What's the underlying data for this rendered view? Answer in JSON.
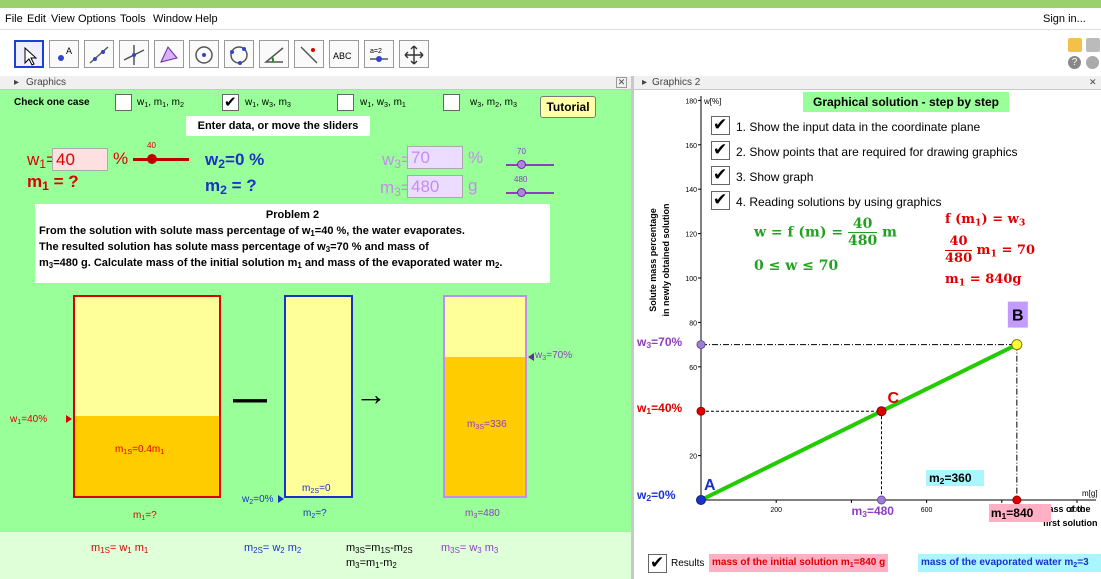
{
  "menu": {
    "items": [
      "File",
      "Edit",
      "View",
      "Options",
      "Tools",
      "Window",
      "Help"
    ],
    "sign_in": "Sign in..."
  },
  "toolbar": {
    "abc_label": "ABC",
    "slider_label": "a=2"
  },
  "left_panel": {
    "title": "Graphics",
    "check_label": "Check one case",
    "cases": [
      {
        "label": "w<sub>1</sub>, m<sub>1</sub>, m<sub>2</sub>",
        "checked": false
      },
      {
        "label": "w<sub>1</sub>, w<sub>3</sub>, m<sub>3</sub>",
        "checked": true
      },
      {
        "label": "w<sub>1</sub>, w<sub>3</sub>, m<sub>1</sub>",
        "checked": false
      },
      {
        "label": "w<sub>3</sub>, m<sub>2</sub>, m<sub>3</sub>",
        "checked": false
      }
    ],
    "tutorial_label": "Tutorial",
    "enter_data": "Enter data, or move the sliders",
    "w1_label": "w<sub>1</sub>=",
    "w1_value": "40",
    "w1_unit": "%",
    "w1_slider_value": "40",
    "w2_text": "w<sub>2</sub>=0 %",
    "w3_label": "w<sub>3</sub>=",
    "w3_value": "70",
    "w3_unit": "%",
    "w3_slider_value": "70",
    "m1_text": "m<sub>1</sub> = ?",
    "m2_text": "m<sub>2</sub> = ?",
    "m3_label": "m<sub>3</sub>=",
    "m3_value": "480",
    "m3_unit": "g",
    "m3_slider_value": "480",
    "problem_title": "Problem 2",
    "problem_lines": [
      "From the solution with solute mass percentage of w<sub>1</sub>=40 %, the water evaporates.",
      "The resulted solution has solute mass percentage of w<sub>3</sub>=70 % and mass of",
      "m<sub>3</sub>=480 g. Calculate mass of the initial solution m<sub>1</sub> and mass of the evaporated water m<sub>2</sub>."
    ],
    "beaker1": {
      "w_label": "w<sub>1</sub>=40%",
      "inner": "m<sub>1S</sub>=0.4m<sub>1</sub>",
      "bottom": "m<sub>1</sub>=?",
      "fill": 0.4
    },
    "beaker2": {
      "w_label": "w<sub>2</sub>=0%",
      "inner": "m<sub>2S</sub>=0",
      "bottom": "m<sub>2</sub>=?"
    },
    "beaker3": {
      "w_label": "w<sub>3</sub>=70%",
      "inner": "m<sub>3S</sub>=336",
      "bottom": "m<sub>3</sub>=480",
      "fill": 0.7
    },
    "minus": "—",
    "arrow": "→",
    "equations": [
      "m<sub>1S</sub>= w<sub>1</sub> m<sub>1</sub>",
      "m<sub>2S</sub>= w<sub>2</sub> m<sub>2</sub>",
      "m<sub>3S</sub>=m<sub>1S</sub>-m<sub>2S</sub>",
      "m<sub>3</sub>=m<sub>1</sub>-m<sub>2</sub>",
      "m<sub>3S</sub>= w<sub>3</sub> m<sub>3</sub>"
    ]
  },
  "right_panel": {
    "title": "Graphics 2",
    "banner": "Graphical solution - step by step",
    "steps": [
      {
        "label": "1. Show the input data in the coordinate plane",
        "checked": true
      },
      {
        "label": "2. Show points that are required for drawing graphics",
        "checked": true
      },
      {
        "label": "3. Show graph",
        "checked": true
      },
      {
        "label": "4. Reading solutions by using graphics",
        "checked": true
      }
    ],
    "formula_lhs": "w = f (m) =",
    "formula_num": "40",
    "formula_den": "480",
    "formula_var": "m",
    "domain_text": "0 ≤ w ≤ 70",
    "eq1": "f (m<sub>1</sub>) = w<sub>3</sub>",
    "eq2_num": "40",
    "eq2_den": "480",
    "eq2_rest": "m<sub>1</sub> = 70",
    "eq3": "m<sub>1</sub> = 840g",
    "results_label": "Results",
    "result1": "mass of the initial solution m<sub>1</sub>=840 g",
    "result2": "mass of the evaporated water m<sub>2</sub>=3"
  },
  "chart_data": {
    "type": "line",
    "ylabel": "w[%]",
    "xlabel": "m[g]",
    "ylabel_side_1": "Solute mass percentage",
    "ylabel_side_2": "in newly obtained solution",
    "xlabel_side_1": "Mass of the",
    "xlabel_side_2": "first solution",
    "xlim": [
      0,
      1000
    ],
    "ylim": [
      0,
      180
    ],
    "x_ticks": [
      200,
      400,
      600,
      800,
      1000
    ],
    "x_tick_labels": [
      "200",
      "",
      "600",
      "",
      "1000"
    ],
    "y_ticks": [
      20,
      40,
      60,
      80,
      100,
      120,
      140,
      160,
      180
    ],
    "y_tick_labels": [
      "20",
      "",
      "60",
      "80",
      "100",
      "120",
      "140",
      "160",
      "180"
    ],
    "line": {
      "x": [
        0,
        840
      ],
      "y": [
        0,
        70
      ]
    },
    "points": [
      {
        "name": "A",
        "x": 0,
        "y": 0,
        "color": "#1a32c8",
        "shown": true
      },
      {
        "name": "B",
        "x": 840,
        "y": 70,
        "color": "#ffff33",
        "shown": true
      },
      {
        "name": "C",
        "x": 480,
        "y": 40,
        "color": "#dd0000",
        "shown": true
      }
    ],
    "labels": {
      "w2": "w<sub>2</sub>=0%",
      "w1": "w<sub>1</sub>=40%",
      "w3": "w<sub>3</sub>=70%",
      "m3": "m<sub>3</sub>=480",
      "m1": "m<sub>1</sub>=840",
      "m2": "m<sub>2</sub>=360"
    },
    "grid": false
  }
}
